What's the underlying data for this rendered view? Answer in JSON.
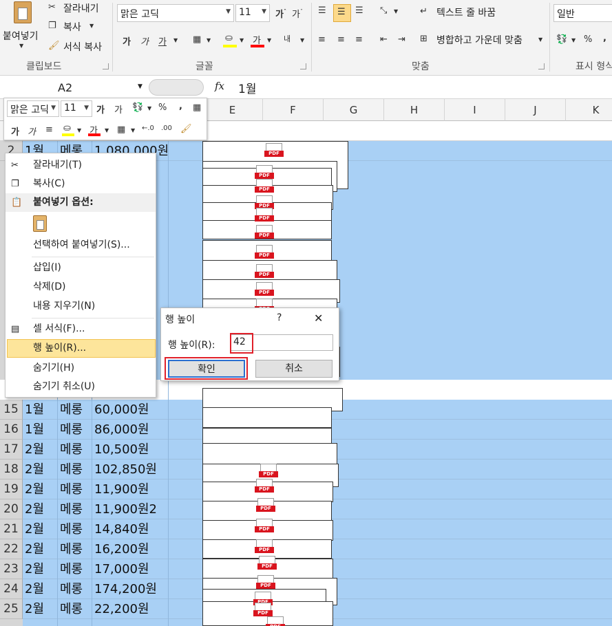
{
  "ribbon": {
    "clipboard": {
      "paste": "붙여넣기",
      "cut": "잘라내기",
      "copy": "복사",
      "format_painter": "서식 복사",
      "group_label": "클립보드"
    },
    "font": {
      "font_name": "맑은 고딕",
      "font_size": "11",
      "group_label": "글꼴",
      "font_color": "#ff0000",
      "fill_color": "#ffff00"
    },
    "alignment": {
      "wrap_text": "텍스트 줄 바꿈",
      "merge_center": "병합하고 가운데 맞춤",
      "group_label": "맞춤"
    },
    "number": {
      "format": "일반",
      "group_label": "표시 형식"
    }
  },
  "formula_bar": {
    "name_box": "A2",
    "fx": "fx",
    "value": "1월"
  },
  "mini_toolbar": {
    "font_name": "맑은 고딕",
    "font_size": "11"
  },
  "columns": [
    "E",
    "F",
    "G",
    "H",
    "I",
    "J",
    "K"
  ],
  "rows": [
    {
      "num": "2",
      "a": "1월",
      "b": "메롱",
      "c": "1,080,000원"
    },
    {
      "num": "15",
      "a": "1월",
      "b": "메롱",
      "c": "60,000원"
    },
    {
      "num": "16",
      "a": "1월",
      "b": "메롱",
      "c": "86,000원"
    },
    {
      "num": "17",
      "a": "2월",
      "b": "메롱",
      "c": "10,500원"
    },
    {
      "num": "18",
      "a": "2월",
      "b": "메롱",
      "c": "102,850원"
    },
    {
      "num": "19",
      "a": "2월",
      "b": "메롱",
      "c": "11,900원"
    },
    {
      "num": "20",
      "a": "2월",
      "b": "메롱",
      "c": "11,900원2"
    },
    {
      "num": "21",
      "a": "2월",
      "b": "메롱",
      "c": "14,840원"
    },
    {
      "num": "22",
      "a": "2월",
      "b": "메롱",
      "c": "16,200원"
    },
    {
      "num": "23",
      "a": "2월",
      "b": "메롱",
      "c": "17,000원"
    },
    {
      "num": "24",
      "a": "2월",
      "b": "메롱",
      "c": "174,200원"
    },
    {
      "num": "25",
      "a": "2월",
      "b": "메롱",
      "c": "22,200원"
    }
  ],
  "pdf_label": "PDF",
  "context_menu": {
    "cut": "잘라내기(T)",
    "copy": "복사(C)",
    "paste_options": "붙여넣기 옵션:",
    "paste_special": "선택하여 붙여넣기(S)...",
    "insert": "삽입(I)",
    "delete": "삭제(D)",
    "clear": "내용 지우기(N)",
    "format_cells": "셀 서식(F)...",
    "row_height": "행 높이(R)...",
    "hide": "숨기기(H)",
    "unhide": "숨기기 취소(U)"
  },
  "dialog": {
    "title": "행 높이",
    "help": "?",
    "close": "✕",
    "label": "행 높이(R):",
    "value": "42",
    "ok": "확인",
    "cancel": "취소"
  },
  "colors": {
    "selection": "#a9d0f5",
    "highlight_red": "#e0202a",
    "menu_hover": "#fde59b"
  }
}
